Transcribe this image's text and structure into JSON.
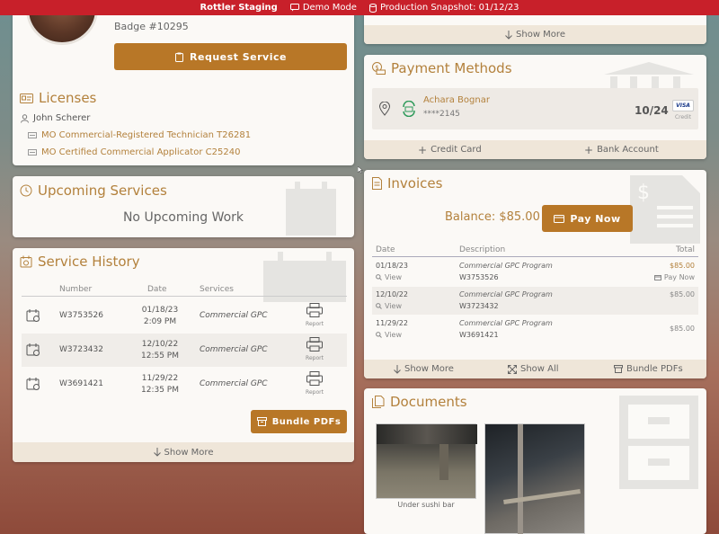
{
  "topbar": {
    "env": "Rottler Staging",
    "demo": "Demo Mode",
    "snapshot": "Production Snapshot: 01/12/23",
    "bg_color": "#c8202a"
  },
  "profile": {
    "badge": "Badge #10295",
    "request_button": "Request Service"
  },
  "licenses": {
    "title": "Licenses",
    "holder": "John Scherer",
    "items": [
      "MO Commercial-Registered Technician T26281",
      "MO Certified Commercial Applicator C25240"
    ]
  },
  "upcoming": {
    "title": "Upcoming Services",
    "empty": "No Upcoming Work"
  },
  "history": {
    "title": "Service History",
    "headers": {
      "number": "Number",
      "date": "Date",
      "services": "Services"
    },
    "rows": [
      {
        "number": "W3753526",
        "date": "01/18/23",
        "time": "2:09 PM",
        "service": "Commercial GPC",
        "action": "Report"
      },
      {
        "number": "W3723432",
        "date": "12/10/22",
        "time": "12:55 PM",
        "service": "Commercial GPC",
        "action": "Report"
      },
      {
        "number": "W3691421",
        "date": "11/29/22",
        "time": "12:35 PM",
        "service": "Commercial GPC",
        "action": "Report"
      }
    ],
    "bundle_button": "Bundle PDFs",
    "show_more": "Show More"
  },
  "top_right": {
    "show_more": "Show More"
  },
  "payment": {
    "title": "Payment Methods",
    "name": "Achara Bognar",
    "masked": "****2145",
    "expiry": "10/24",
    "brand": "VISA",
    "type": "Credit",
    "add_card": "Credit Card",
    "add_bank": "Bank Account"
  },
  "invoices": {
    "title": "Invoices",
    "balance": "Balance: $85.00",
    "pay_button": "Pay Now",
    "headers": {
      "date": "Date",
      "description": "Description",
      "total": "Total"
    },
    "rows": [
      {
        "date": "01/18/23",
        "desc": "Commercial GPC Program",
        "number": "W3753526",
        "total": "$85.00",
        "view": "View",
        "pay": "Pay Now"
      },
      {
        "date": "12/10/22",
        "desc": "Commercial GPC Program",
        "number": "W3723432",
        "total": "$85.00",
        "view": "View",
        "pay": ""
      },
      {
        "date": "11/29/22",
        "desc": "Commercial GPC Program",
        "number": "W3691421",
        "total": "$85.00",
        "view": "View",
        "pay": ""
      }
    ],
    "show_more": "Show More",
    "show_all": "Show All",
    "bundle": "Bundle PDFs"
  },
  "documents": {
    "title": "Documents",
    "caption1": "Under sushi bar"
  },
  "colors": {
    "accent": "#b3813c",
    "button": "#b87727"
  }
}
